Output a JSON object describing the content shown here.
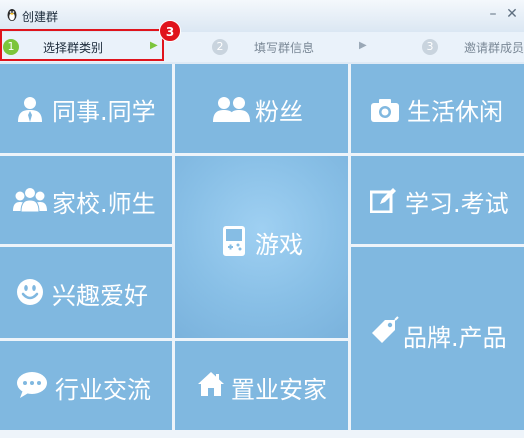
{
  "window": {
    "title": "创建群"
  },
  "steps": [
    {
      "num": "1",
      "label": "选择群类别"
    },
    {
      "num": "2",
      "label": "填写群信息"
    },
    {
      "num": "3",
      "label": "邀请群成员"
    }
  ],
  "annotation": {
    "badge": "3"
  },
  "categories": [
    {
      "label": "同事.同学",
      "icon": "person-icon"
    },
    {
      "label": "粉丝",
      "icon": "people-icon"
    },
    {
      "label": "生活休闲",
      "icon": "camera-icon"
    },
    {
      "label": "家校.师生",
      "icon": "teacher-students-icon"
    },
    {
      "label": "游戏",
      "icon": "gamepad-icon"
    },
    {
      "label": "学习.考试",
      "icon": "edit-icon"
    },
    {
      "label": "兴趣爱好",
      "icon": "smile-icon"
    },
    {
      "label": "品牌.产品",
      "icon": "tag-icon"
    },
    {
      "label": "行业交流",
      "icon": "chat-bubble-icon"
    },
    {
      "label": "置业安家",
      "icon": "house-icon"
    }
  ],
  "colors": {
    "tile": "#80b8e0",
    "active_step": "#7cc53b",
    "highlight": "#e0141c"
  }
}
